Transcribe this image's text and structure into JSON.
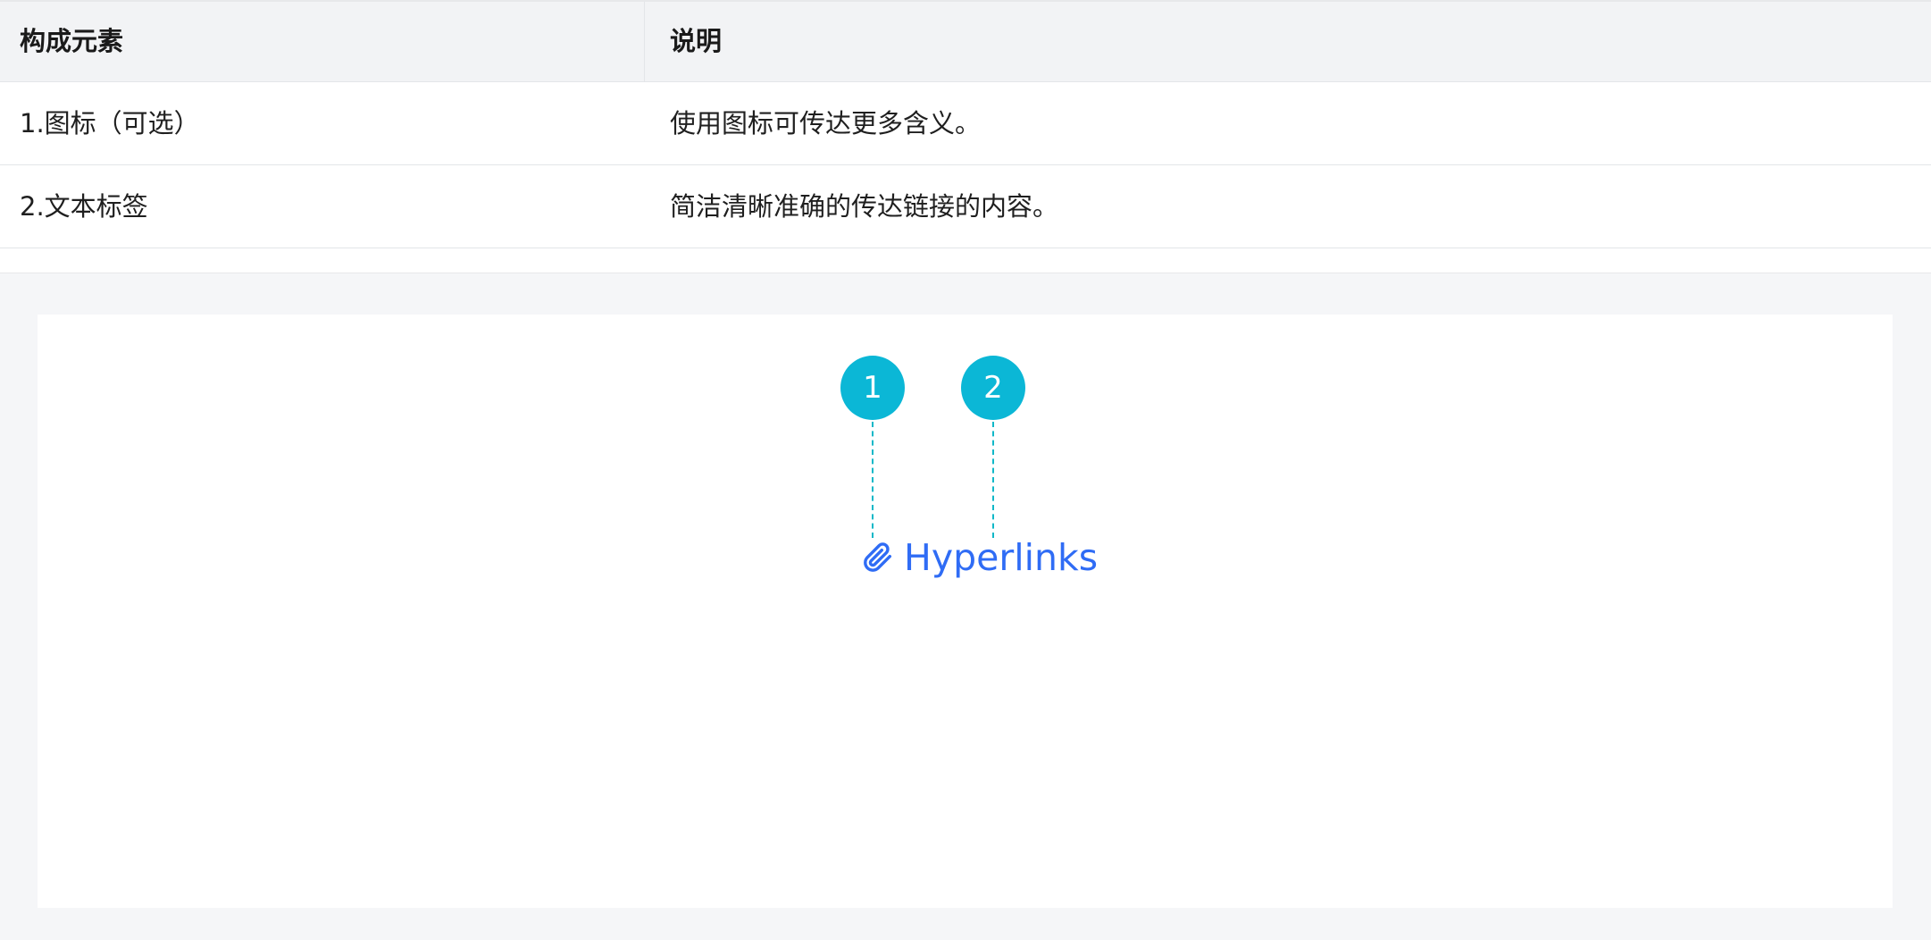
{
  "table": {
    "headers": [
      "构成元素",
      "说明"
    ],
    "rows": [
      [
        "1.图标（可选）",
        "使用图标可传达更多含义。"
      ],
      [
        "2.文本标签",
        "简洁清晰准确的传达链接的内容。"
      ]
    ]
  },
  "demo": {
    "markers": [
      "1",
      "2"
    ],
    "link_text": "Hyperlinks",
    "link_icon": "paperclip-icon",
    "colors": {
      "marker": "#0bb7d6",
      "leader": "#10b8c8",
      "link": "#2f6cf5"
    }
  }
}
